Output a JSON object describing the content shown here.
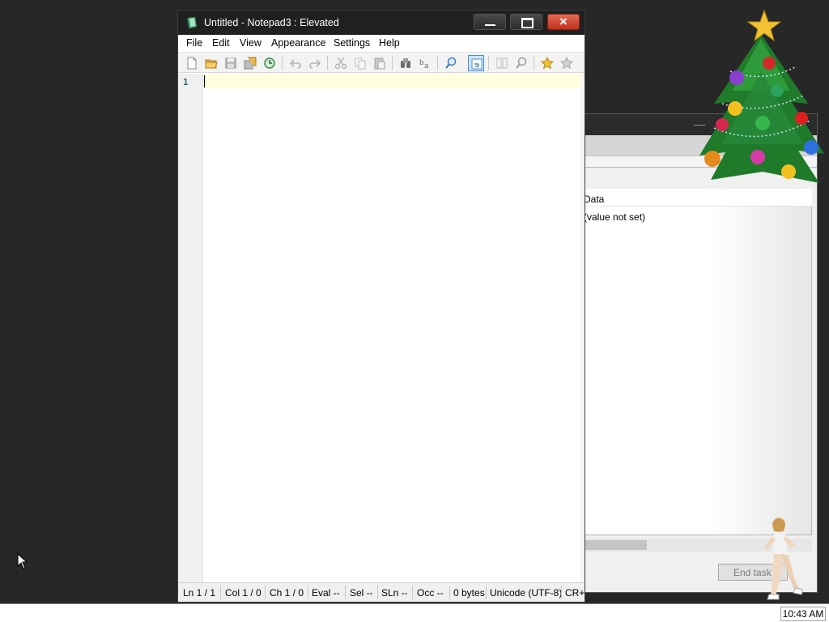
{
  "notepad": {
    "title": "Untitled - Notepad3 : Elevated",
    "window_buttons": {
      "close_glyph": "×"
    },
    "menu": [
      "File",
      "Edit",
      "View",
      "Appearance",
      "Settings",
      "Help"
    ],
    "toolbar_icons": [
      "new-file-icon",
      "open-folder-icon",
      "save-icon",
      "save-as-icon",
      "reload-icon",
      "undo-icon",
      "redo-icon",
      "cut-icon",
      "copy-icon",
      "paste-icon",
      "find-icon",
      "replace-icon",
      "zoom-icon",
      "word-wrap-icon",
      "toggle-view-icon",
      "zoom-in-icon",
      "favorite-icon",
      "add-favorite-icon"
    ],
    "editor": {
      "line_number": "1",
      "content": ""
    },
    "status": {
      "ln": "Ln  1 / 1",
      "col": "Col  1 / 0",
      "ch": "Ch  1 / 0",
      "eval": "Eval  --",
      "sel": "Sel  --",
      "sln": "SLn  --",
      "occ": "Occ  --",
      "size": "0 bytes",
      "encoding": "Unicode (UTF-8)",
      "eol": "CR+"
    }
  },
  "background_window": {
    "column_header": "Data",
    "row_value": "(value not set)",
    "end_task_label": "End task",
    "minimize_glyph": "—"
  },
  "taskbar": {
    "clock": "10:43 AM"
  },
  "colors": {
    "desktop": "#272727",
    "titlebar": "#202020",
    "close_button": "#c2301d",
    "current_line": "#ffffe0",
    "line_number": "#2d6f77"
  }
}
